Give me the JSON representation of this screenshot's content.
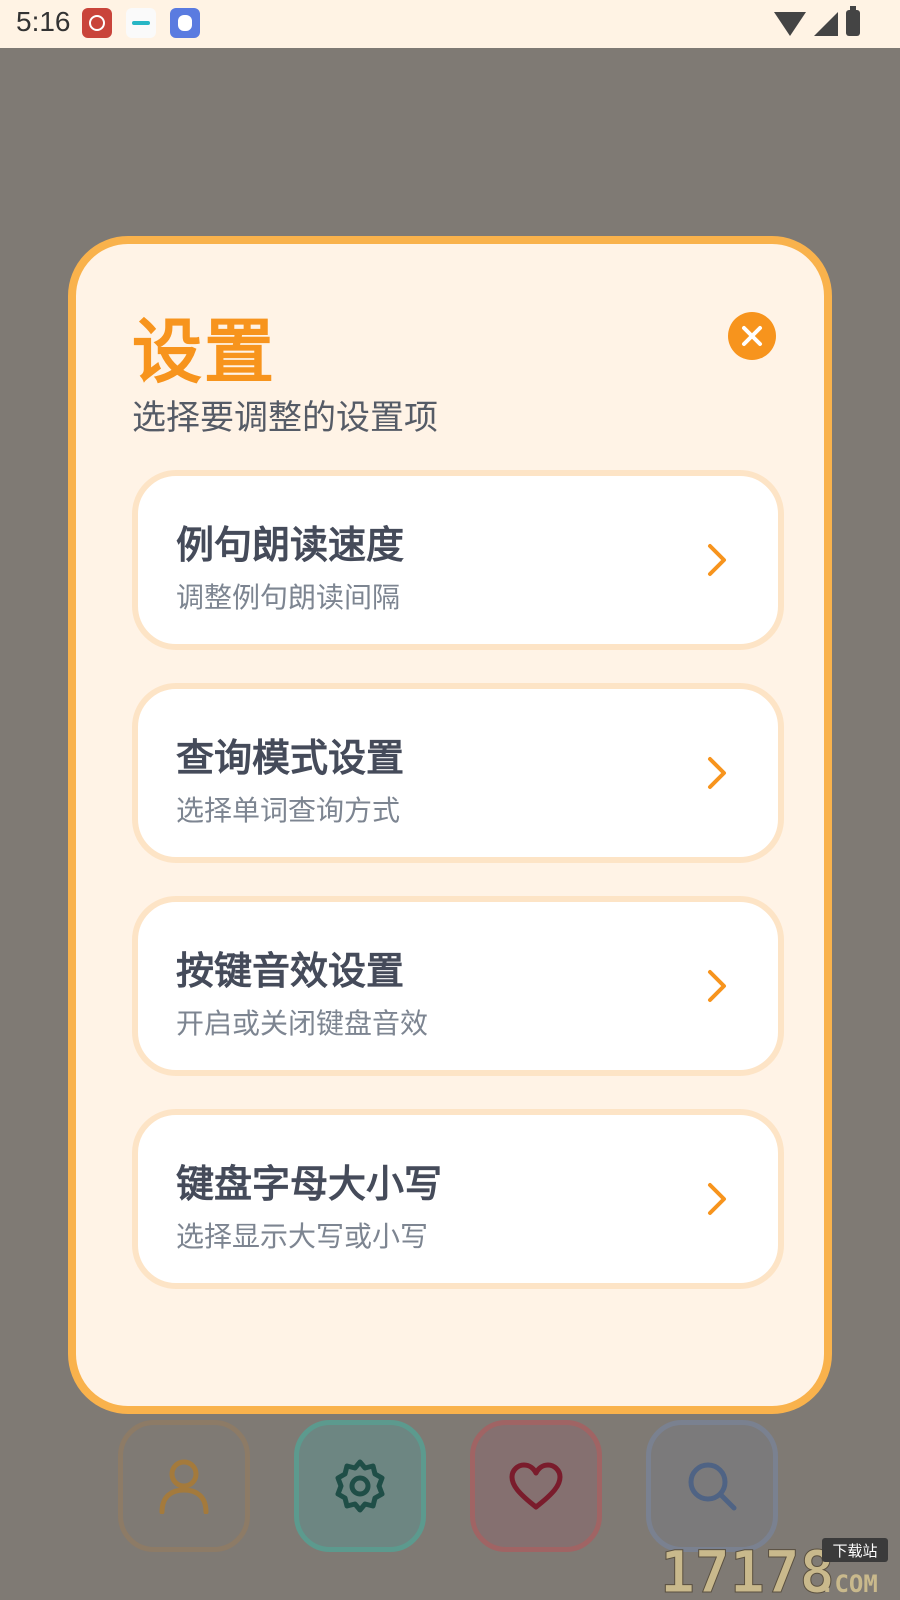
{
  "status_bar": {
    "time": "5:16"
  },
  "dialog": {
    "title": "设置",
    "subtitle": "选择要调整的设置项",
    "options": [
      {
        "title": "例句朗读速度",
        "description": "调整例句朗读间隔"
      },
      {
        "title": "查询模式设置",
        "description": "选择单词查询方式"
      },
      {
        "title": "按键音效设置",
        "description": "开启或关闭键盘音效"
      },
      {
        "title": "键盘字母大小写",
        "description": "选择显示大写或小写"
      }
    ]
  },
  "bottom_nav": [
    "user-icon",
    "gear-icon",
    "heart-icon",
    "search-icon"
  ],
  "watermark": {
    "number": "17178",
    "tag": "下载站",
    "suffix": ".COM"
  },
  "colors": {
    "accent": "#f7941d",
    "dialog_border": "#f9b24c",
    "dialog_bg": "#fff3e6",
    "card_border": "#fde4c6",
    "title_text": "#454b5a",
    "desc_text": "#7d8591"
  }
}
